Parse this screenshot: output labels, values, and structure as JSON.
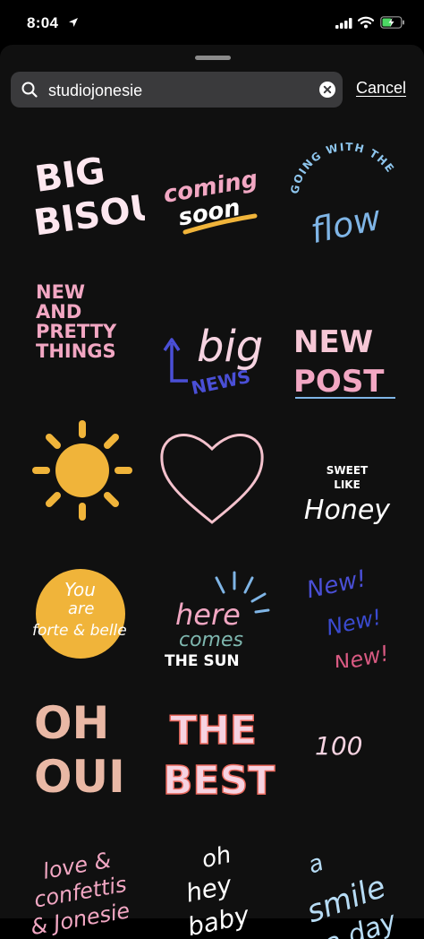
{
  "status": {
    "time": "8:04",
    "icons": [
      "location-arrow-icon",
      "cellular-signal-icon",
      "wifi-icon",
      "battery-charging-icon"
    ]
  },
  "search": {
    "query": "studiojonesie",
    "cancel_label": "Cancel",
    "icons": [
      "search-icon",
      "clear-icon"
    ]
  },
  "stickers": {
    "big_bisou": [
      "BIG",
      "BISOU"
    ],
    "coming_soon": [
      "coming",
      "soon"
    ],
    "going_with_flow": [
      "GOING WITH THE",
      "flow"
    ],
    "new_pretty": [
      "NEW",
      "AND",
      "PRETTY",
      "THINGS"
    ],
    "big_news": [
      "big",
      "NEWS"
    ],
    "new_post": [
      "NEW",
      "POST"
    ],
    "sweet_honey": [
      "SWEET",
      "LIKE",
      "Honey"
    ],
    "forte_belle": [
      "You",
      "are",
      "forte & belle"
    ],
    "here_comes_sun": [
      "here",
      "comes",
      "THE SUN"
    ],
    "new_new": [
      "New!",
      "New!",
      "New!"
    ],
    "oh_oui": [
      "OH",
      "OUI"
    ],
    "the_best": [
      "THE",
      "BEST"
    ],
    "hundred": "100",
    "love_confettis": [
      "love &",
      "confettis",
      "& Jonesie"
    ],
    "oh_hey_baby": [
      "oh",
      "hey",
      "baby"
    ],
    "smile_day": [
      "a",
      "smile",
      "a day"
    ]
  },
  "colors": {
    "pink": "#f4b3c5",
    "peach": "#e8a98e",
    "blue": "#7fb5e6",
    "purple": "#4a4fd6",
    "yellow": "#f0b43a",
    "teal": "#7fb8b0",
    "coral": "#e8685c",
    "white": "#ffffff"
  }
}
